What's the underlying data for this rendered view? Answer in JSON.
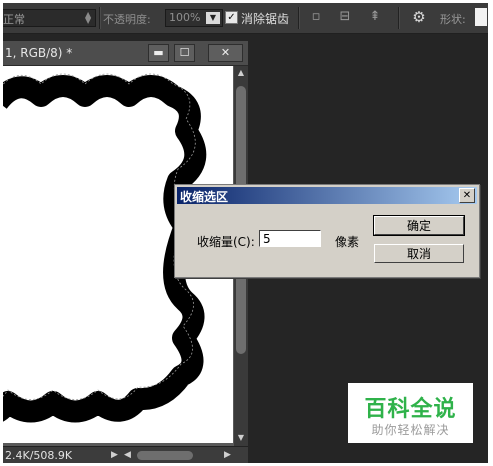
{
  "options_bar": {
    "mode_value": "正常",
    "opacity_label": "不透明度:",
    "opacity_value": "100%",
    "antialias_checked": true,
    "antialias_label": "消除锯齿",
    "shape_label": "形状:",
    "icons": [
      "mode-spinner-icon",
      "opacity-dropdown-icon",
      "new-layer-icon",
      "align-icon",
      "arrange-icon",
      "gear-icon"
    ]
  },
  "document": {
    "title": "1, RGB/8) *",
    "minimize_glyph": "▬",
    "maximize_glyph": "☐",
    "close_glyph": "✕",
    "status_text": "2.4K/508.9K"
  },
  "dialog": {
    "title": "收缩选区",
    "close_glyph": "✕",
    "contract_label": "收缩量(C):",
    "contract_value": "5",
    "unit": "像素",
    "ok_button": "确定",
    "cancel_button": "取消"
  },
  "watermark": {
    "brand": "百科全说",
    "tagline": "助你轻松解决"
  },
  "colors": {
    "workspace": "#252525",
    "options_bar": "#3b3b3b",
    "dialog_title": "#0a246a",
    "watermark_green": "#2fb24a"
  }
}
